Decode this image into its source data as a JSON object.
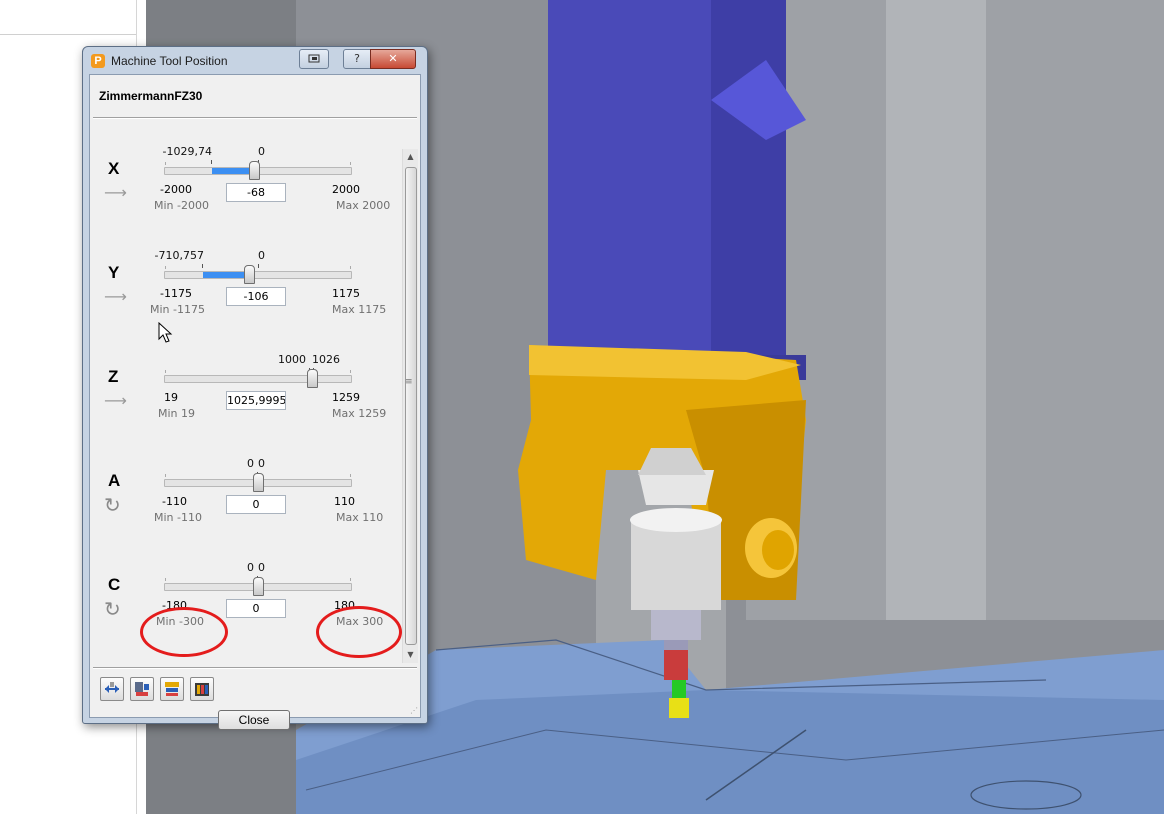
{
  "window": {
    "title": "Machine Tool Position",
    "help_label": "?",
    "close_glyph": "✕"
  },
  "machine": {
    "name": "ZimmermannFZ30"
  },
  "axes": [
    {
      "letter": "X",
      "type": "linear",
      "current_label": "-1029,74",
      "zero_label": "0",
      "min": "-2000",
      "max": "2000",
      "min_caption": "Min -2000",
      "max_caption": "Max 2000",
      "value": "-68"
    },
    {
      "letter": "Y",
      "type": "linear",
      "current_label": "-710,757",
      "zero_label": "0",
      "min": "-1175",
      "max": "1175",
      "min_caption": "Min -1175",
      "max_caption": "Max 1175",
      "value": "-106"
    },
    {
      "letter": "Z",
      "type": "linear",
      "current_label": "1000",
      "zero_label": "1026",
      "min": "19",
      "max": "1259",
      "min_caption": "Min 19",
      "max_caption": "Max 1259",
      "value": "1025,9995"
    },
    {
      "letter": "A",
      "type": "rotary",
      "current_label": "0",
      "zero_label": "0",
      "min": "-110",
      "max": "110",
      "min_caption": "Min -110",
      "max_caption": "Max 110",
      "value": "0"
    },
    {
      "letter": "C",
      "type": "rotary",
      "current_label": "0",
      "zero_label": "0",
      "min": "-180",
      "max": "180",
      "min_caption": "Min -300",
      "max_caption": "Max 300",
      "value": "0"
    }
  ],
  "icons": {
    "app": "powermill-p-icon",
    "linear_axis": "arrow-right-icon",
    "rotary_axis": "rotate-icon"
  },
  "app_icon_letter": "P",
  "toolbar": [
    "align-tool-icon",
    "machine-to-tool-icon",
    "tool-to-machine-icon",
    "machine-settings-icon"
  ],
  "buttons": {
    "close_label": "Close"
  },
  "colors": {
    "accent": "#3c8ff2",
    "highlight": "#e41c1c",
    "spindle_head": "#e3a806",
    "column": "#4a4ab8"
  }
}
